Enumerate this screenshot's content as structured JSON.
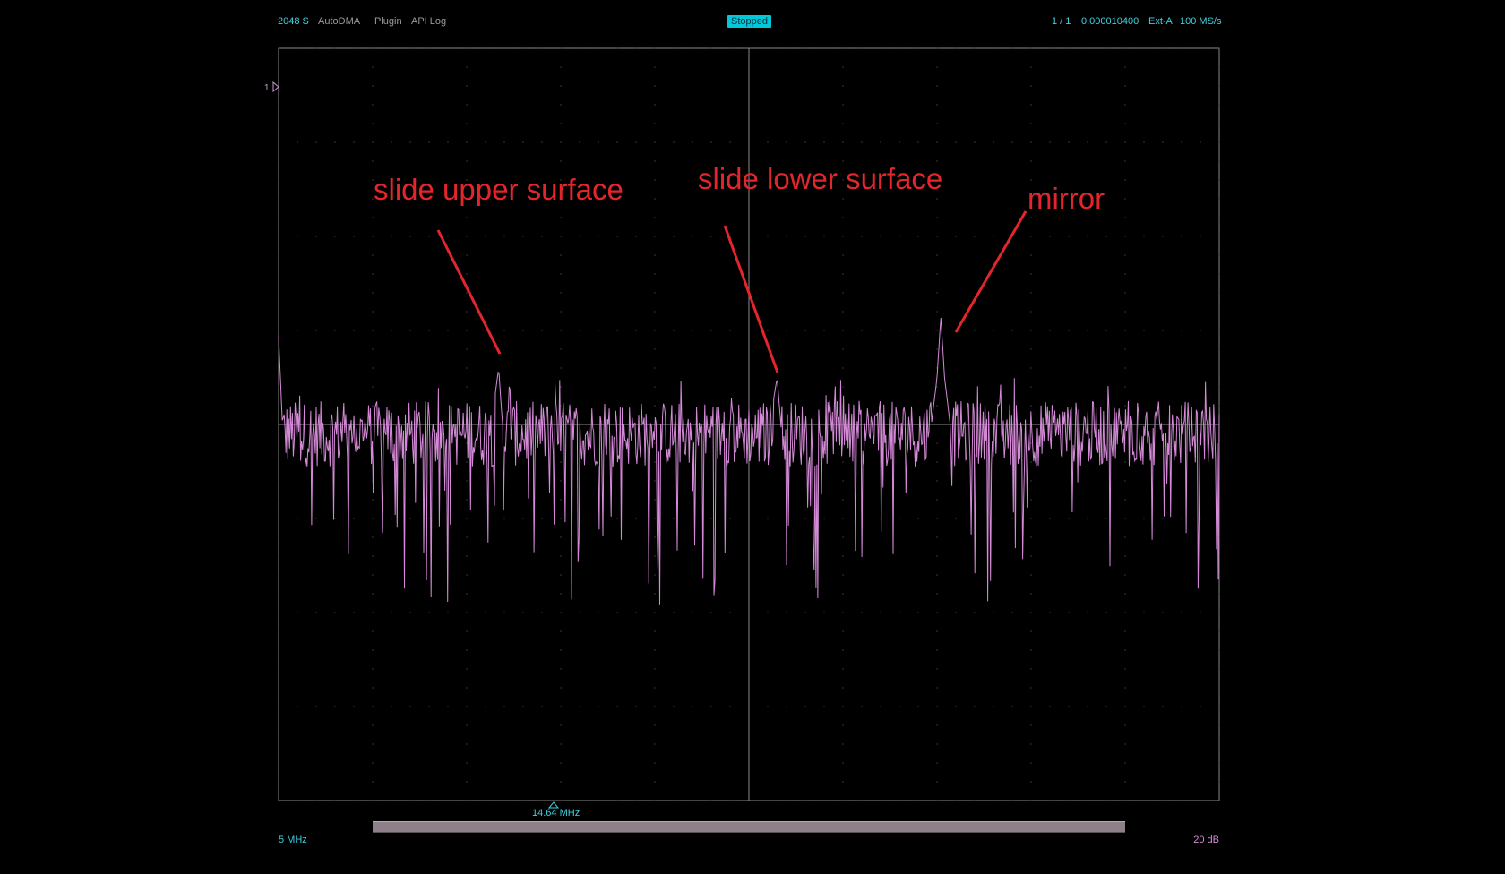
{
  "toolbar": {
    "samples": "2048 S",
    "auto_dma": "AutoDMA",
    "plugin": "Plugin",
    "api_log": "API Log",
    "status": "Stopped",
    "record": "1 / 1",
    "timestamp": "0.000010400",
    "clock": "Ext-A",
    "rate": "100 MS/s"
  },
  "channel_marker": "1",
  "annotations": {
    "upper": "slide upper surface",
    "lower": "slide lower surface",
    "mirror": "mirror"
  },
  "bottom": {
    "freq_marker": "14.64 MHz",
    "x_scale": "5 MHz",
    "y_scale": "20 dB"
  },
  "colors": {
    "trace": "#d58ad8",
    "grid": "#8a8a8a",
    "annotation": "#e3262b",
    "accent": "#3fd0e0"
  },
  "chart_data": {
    "type": "line",
    "title": "",
    "xlabel": "",
    "ylabel": "",
    "x_unit": "MHz",
    "xlim": [
      0,
      50
    ],
    "ylim": [
      -160,
      0
    ],
    "grid": true,
    "series": [
      {
        "values_db": [
          [
            0,
            -61
          ],
          [
            0.2,
            -80
          ],
          [
            11.5,
            -74
          ],
          [
            11.7,
            -68
          ],
          [
            11.9,
            -80
          ],
          [
            26.3,
            -75
          ],
          [
            26.5,
            -70
          ],
          [
            26.7,
            -80
          ],
          [
            34.7,
            -80
          ],
          [
            35.0,
            -70
          ],
          [
            35.2,
            -57
          ],
          [
            35.4,
            -70
          ],
          [
            35.7,
            -80
          ]
        ]
      }
    ]
  }
}
